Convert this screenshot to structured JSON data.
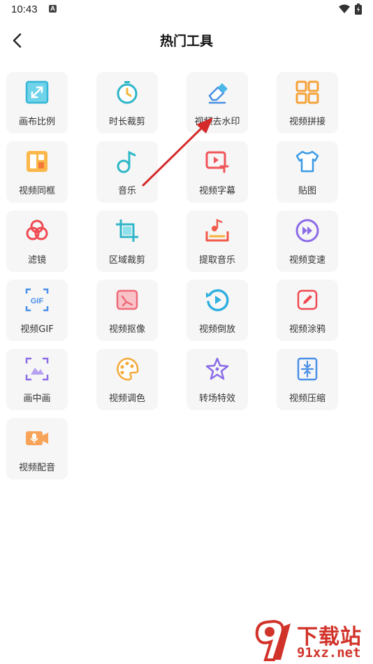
{
  "status_bar": {
    "time": "10:43",
    "notification_letter": "A"
  },
  "header": {
    "title": "热门工具"
  },
  "tools": [
    {
      "label": "画布比例",
      "icon": "aspect-ratio-icon"
    },
    {
      "label": "时长裁剪",
      "icon": "stopwatch-icon"
    },
    {
      "label": "视频去水印",
      "icon": "eraser-icon"
    },
    {
      "label": "视频拼接",
      "icon": "grid-join-icon"
    },
    {
      "label": "视频同框",
      "icon": "split-screen-icon"
    },
    {
      "label": "音乐",
      "icon": "music-note-icon"
    },
    {
      "label": "视频字幕",
      "icon": "subtitle-icon"
    },
    {
      "label": "贴图",
      "icon": "shirt-sticker-icon"
    },
    {
      "label": "滤镜",
      "icon": "filter-icon"
    },
    {
      "label": "区域裁剪",
      "icon": "crop-icon"
    },
    {
      "label": "提取音乐",
      "icon": "extract-music-icon"
    },
    {
      "label": "视频变速",
      "icon": "fast-forward-icon"
    },
    {
      "label": "视频GIF",
      "icon": "gif-icon"
    },
    {
      "label": "视频抠像",
      "icon": "cutout-image-icon"
    },
    {
      "label": "视频倒放",
      "icon": "reverse-play-icon"
    },
    {
      "label": "视频涂鸦",
      "icon": "doodle-pen-icon"
    },
    {
      "label": "画中画",
      "icon": "picture-in-picture-icon"
    },
    {
      "label": "视频调色",
      "icon": "palette-icon"
    },
    {
      "label": "转场特效",
      "icon": "sparkle-star-icon"
    },
    {
      "label": "视频压缩",
      "icon": "compress-icon"
    },
    {
      "label": "视频配音",
      "icon": "voiceover-icon"
    }
  ],
  "watermark": {
    "brand": "下载站",
    "url": "91xz.net"
  },
  "colors": {
    "red_arrow": "#d42a2a",
    "tile_bg": "#f6f6f6"
  }
}
